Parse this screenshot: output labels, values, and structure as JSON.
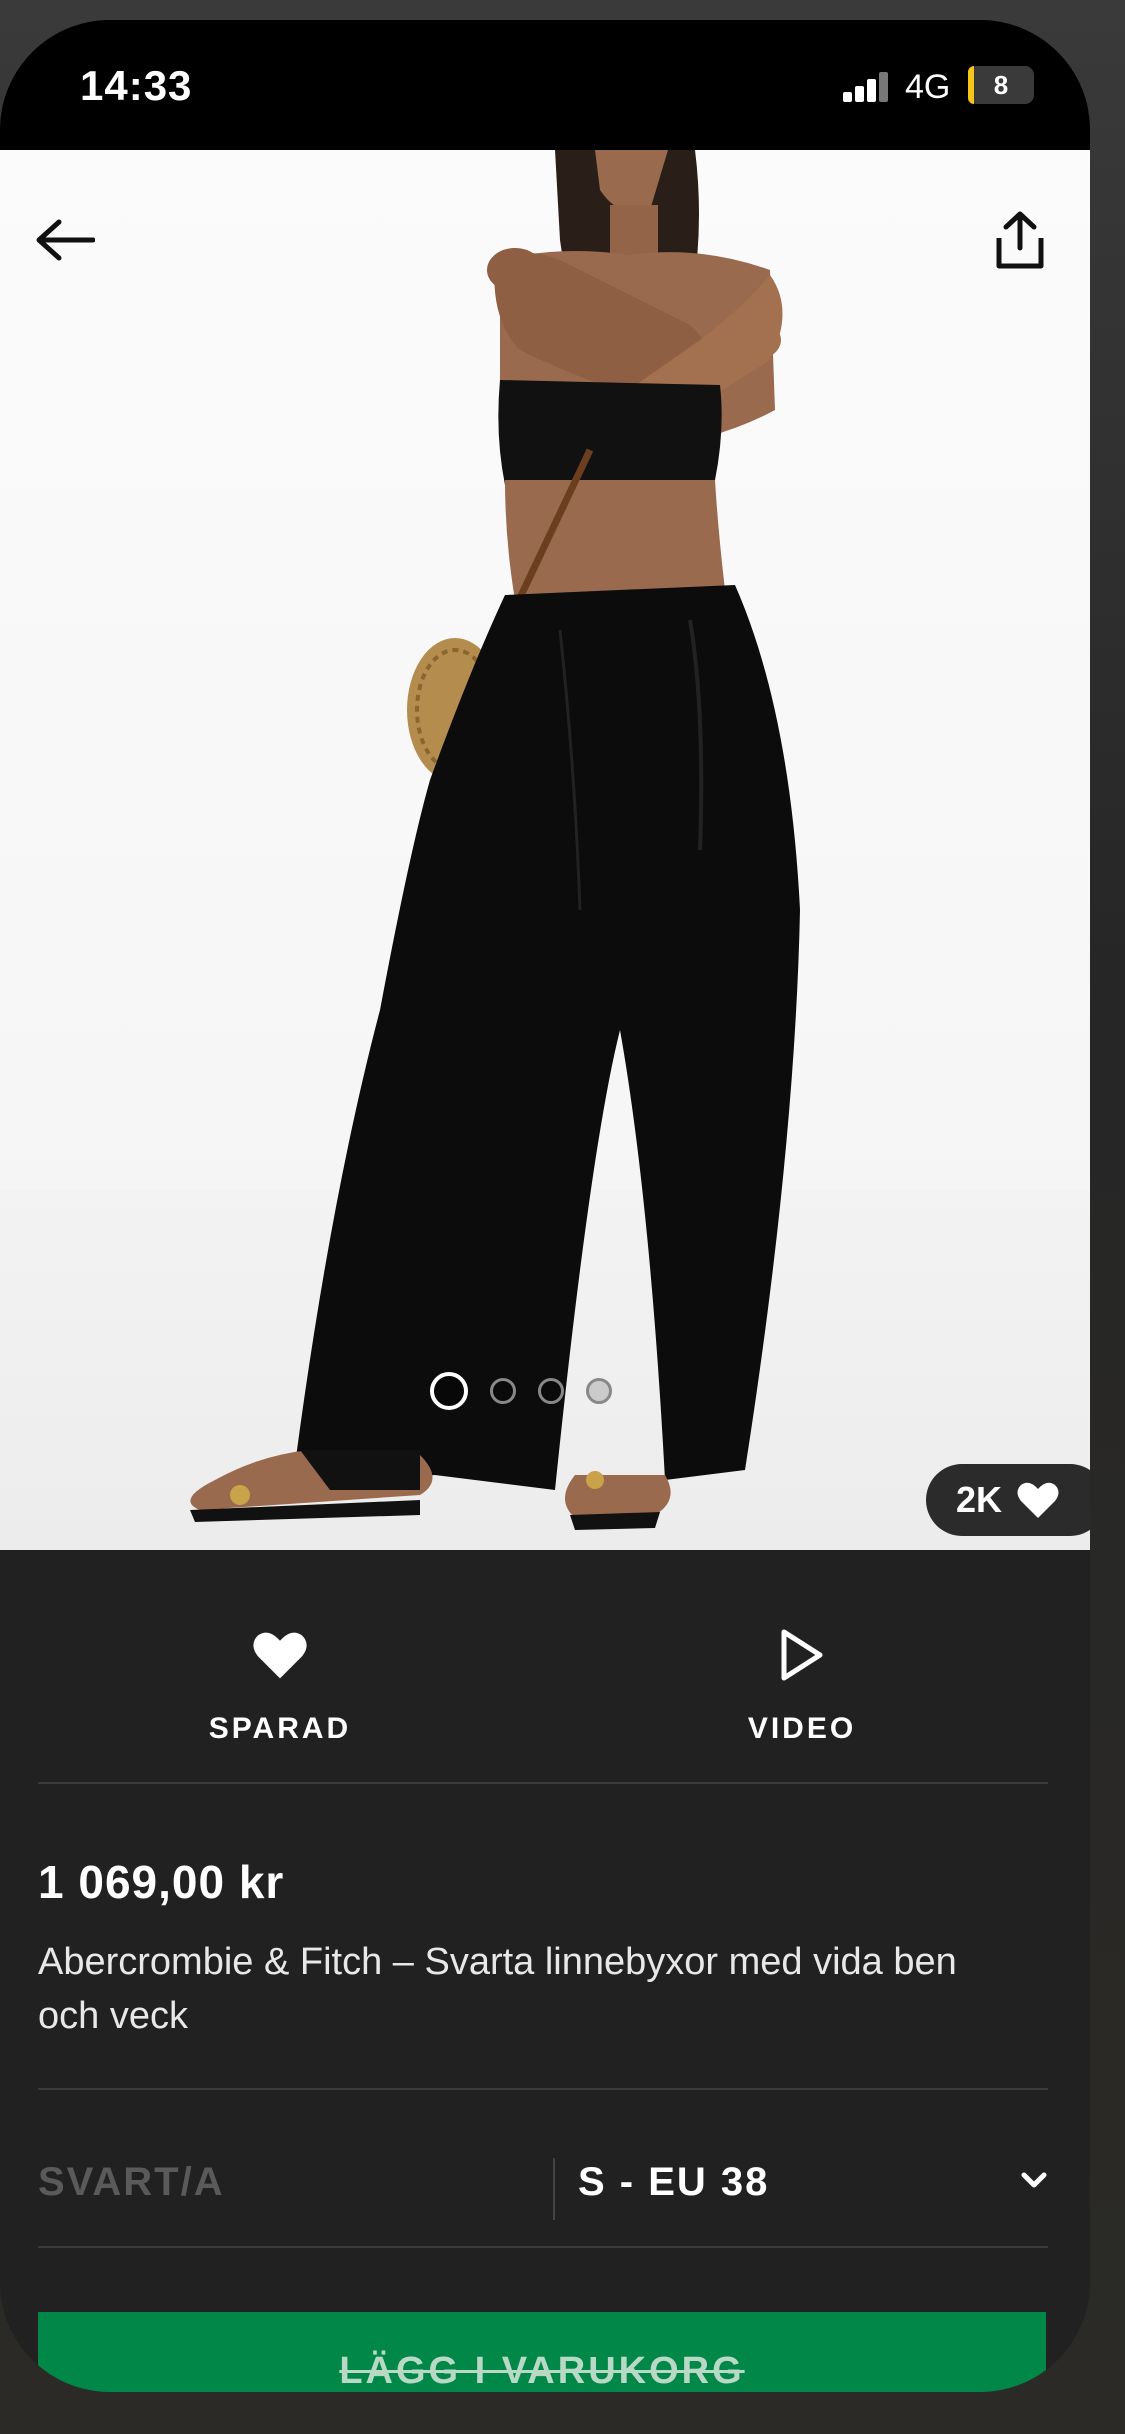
{
  "status_bar": {
    "time": "14:33",
    "network": "4G",
    "battery": "8",
    "battery_color": "#f5c518"
  },
  "header": {
    "back_icon": "arrow-left-icon",
    "share_icon": "share-icon"
  },
  "gallery": {
    "total_images": 4,
    "active_index": 0,
    "likes_count": "2K",
    "likes_icon": "heart-icon"
  },
  "actions": {
    "save_label": "SPARAD",
    "save_icon": "heart-filled-icon",
    "video_label": "VIDEO",
    "video_icon": "play-outline-icon"
  },
  "product": {
    "price": "1 069,00 kr",
    "title": "Abercrombie & Fitch – Svarta linnebyxor med vida ben och veck"
  },
  "selectors": {
    "color": "SVART/A",
    "size": "S - EU 38",
    "size_icon": "chevron-down-icon"
  },
  "cart": {
    "button_label": "LÄGG I VARUKORG",
    "button_color": "#018849"
  }
}
